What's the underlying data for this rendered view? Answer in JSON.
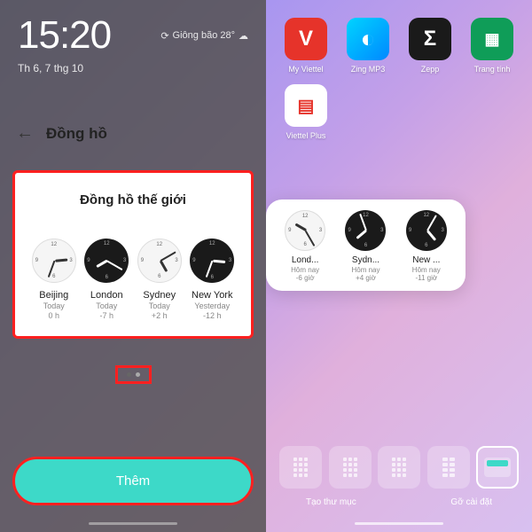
{
  "left": {
    "status_time": "15:20",
    "weather_text": "Giông bão 28°",
    "date_text": "Th 6, 7 thg 10",
    "sheet_title": "Đồng hồ",
    "card_title": "Đồng hồ thế giới",
    "clocks": [
      {
        "city": "Beijing",
        "day": "Today",
        "offset": "0 h",
        "dark": false,
        "hour_deg": 85,
        "min_deg": 200
      },
      {
        "city": "London",
        "day": "Today",
        "offset": "-7 h",
        "dark": true,
        "hour_deg": 240,
        "min_deg": 120
      },
      {
        "city": "Sydney",
        "day": "Today",
        "offset": "+2 h",
        "dark": false,
        "hour_deg": 150,
        "min_deg": 60
      },
      {
        "city": "New York",
        "day": "Yesterday",
        "offset": "-12 h",
        "dark": true,
        "hour_deg": 95,
        "min_deg": 200
      }
    ],
    "add_button": "Thêm"
  },
  "right": {
    "apps": [
      {
        "label": "My Viettel",
        "glyph": "V",
        "cls": "icon-viettel"
      },
      {
        "label": "Zing MP3",
        "glyph": "◐",
        "cls": "icon-zing"
      },
      {
        "label": "Zepp",
        "glyph": "Σ",
        "cls": "icon-zepp"
      },
      {
        "label": "Trang tính",
        "glyph": "▦",
        "cls": "icon-sheets"
      },
      {
        "label": "Viettel Plus",
        "glyph": "▤",
        "cls": "icon-sim"
      }
    ],
    "widget_clocks": [
      {
        "city": "Lond...",
        "day": "Hôm nay",
        "offset": "-6 giờ",
        "dark": false,
        "hour_deg": 300,
        "min_deg": 150
      },
      {
        "city": "Sydn...",
        "day": "Hôm nay",
        "offset": "+4 giờ",
        "dark": true,
        "hour_deg": 230,
        "min_deg": 340
      },
      {
        "city": "New ...",
        "day": "Hôm nay",
        "offset": "-11 giờ",
        "dark": true,
        "hour_deg": 140,
        "min_deg": 30
      }
    ],
    "dock_label_left": "Tạo thư mục",
    "dock_label_right": "Gỡ cài đặt"
  }
}
